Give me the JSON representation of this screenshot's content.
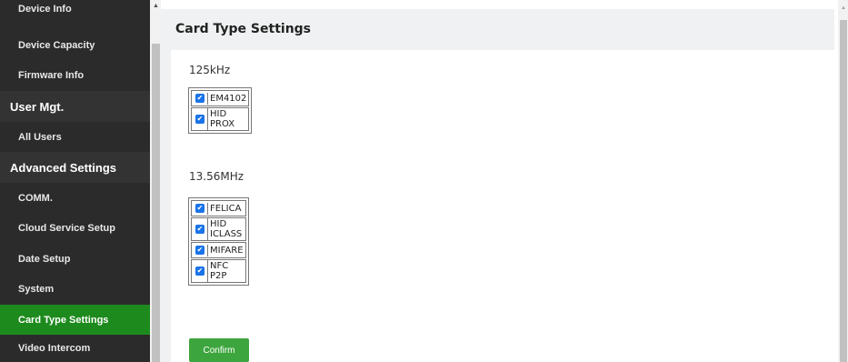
{
  "sidebar": {
    "items": [
      {
        "label": "Device Info",
        "type": "item",
        "active": false
      },
      {
        "label": "Device Capacity",
        "type": "item",
        "active": false
      },
      {
        "label": "Firmware Info",
        "type": "item",
        "active": false
      },
      {
        "label": "User Mgt.",
        "type": "group",
        "active": false
      },
      {
        "label": "All Users",
        "type": "item",
        "active": false
      },
      {
        "label": "Advanced Settings",
        "type": "group",
        "active": false
      },
      {
        "label": "COMM.",
        "type": "item",
        "active": false
      },
      {
        "label": "Cloud Service Setup",
        "type": "item",
        "active": false
      },
      {
        "label": "Date Setup",
        "type": "item",
        "active": false
      },
      {
        "label": "System",
        "type": "item",
        "active": false
      },
      {
        "label": "Card Type Settings",
        "type": "item",
        "active": true
      },
      {
        "label": "Video Intercom",
        "type": "item",
        "active": false
      }
    ]
  },
  "page": {
    "title": "Card Type Settings",
    "sections": [
      {
        "label": "125kHz",
        "cards": [
          {
            "name": "EM4102",
            "checked": true
          },
          {
            "name": "HID\nPROX",
            "checked": true
          }
        ]
      },
      {
        "label": "13.56MHz",
        "cards": [
          {
            "name": "FELICA",
            "checked": true
          },
          {
            "name": "HID\nICLASS",
            "checked": true
          },
          {
            "name": "MIFARE",
            "checked": true
          },
          {
            "name": "NFC\nP2P",
            "checked": true
          }
        ]
      }
    ],
    "confirm_label": "Confirm"
  },
  "colors": {
    "sidebar_bg": "#2b2b2b",
    "active_item": "#1d8a1d",
    "confirm_button": "#3da53d",
    "checkbox": "#1a73e8"
  },
  "icons": {
    "checkbox_mark": "✔",
    "scroll_up": "▲"
  }
}
